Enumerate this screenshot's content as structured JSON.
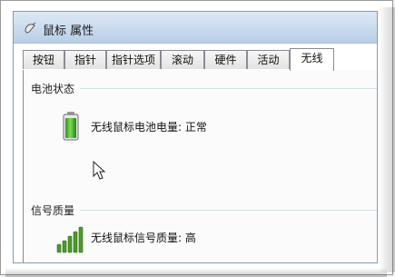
{
  "window": {
    "title": "鼠标 属性",
    "icon": "mouse-icon"
  },
  "tabs": [
    {
      "label": "按钮",
      "active": false
    },
    {
      "label": "指针",
      "active": false
    },
    {
      "label": "指针选项",
      "active": false
    },
    {
      "label": "滚动",
      "active": false
    },
    {
      "label": "硬件",
      "active": false
    },
    {
      "label": "活动",
      "active": false
    },
    {
      "label": "无线",
      "active": true
    }
  ],
  "battery": {
    "group_label": "电池状态",
    "status_text": "无线鼠标电池电量: 正常",
    "icon": "battery-full-icon",
    "fill_level": 1.0
  },
  "signal": {
    "group_label": "信号质量",
    "status_text": "无线鼠标信号质量: 高",
    "icon": "signal-strength-icon",
    "bars_lit": 5,
    "bars_total": 5
  },
  "colors": {
    "battery_green": "#3fae2a",
    "signal_green": "#4c9a2a"
  }
}
